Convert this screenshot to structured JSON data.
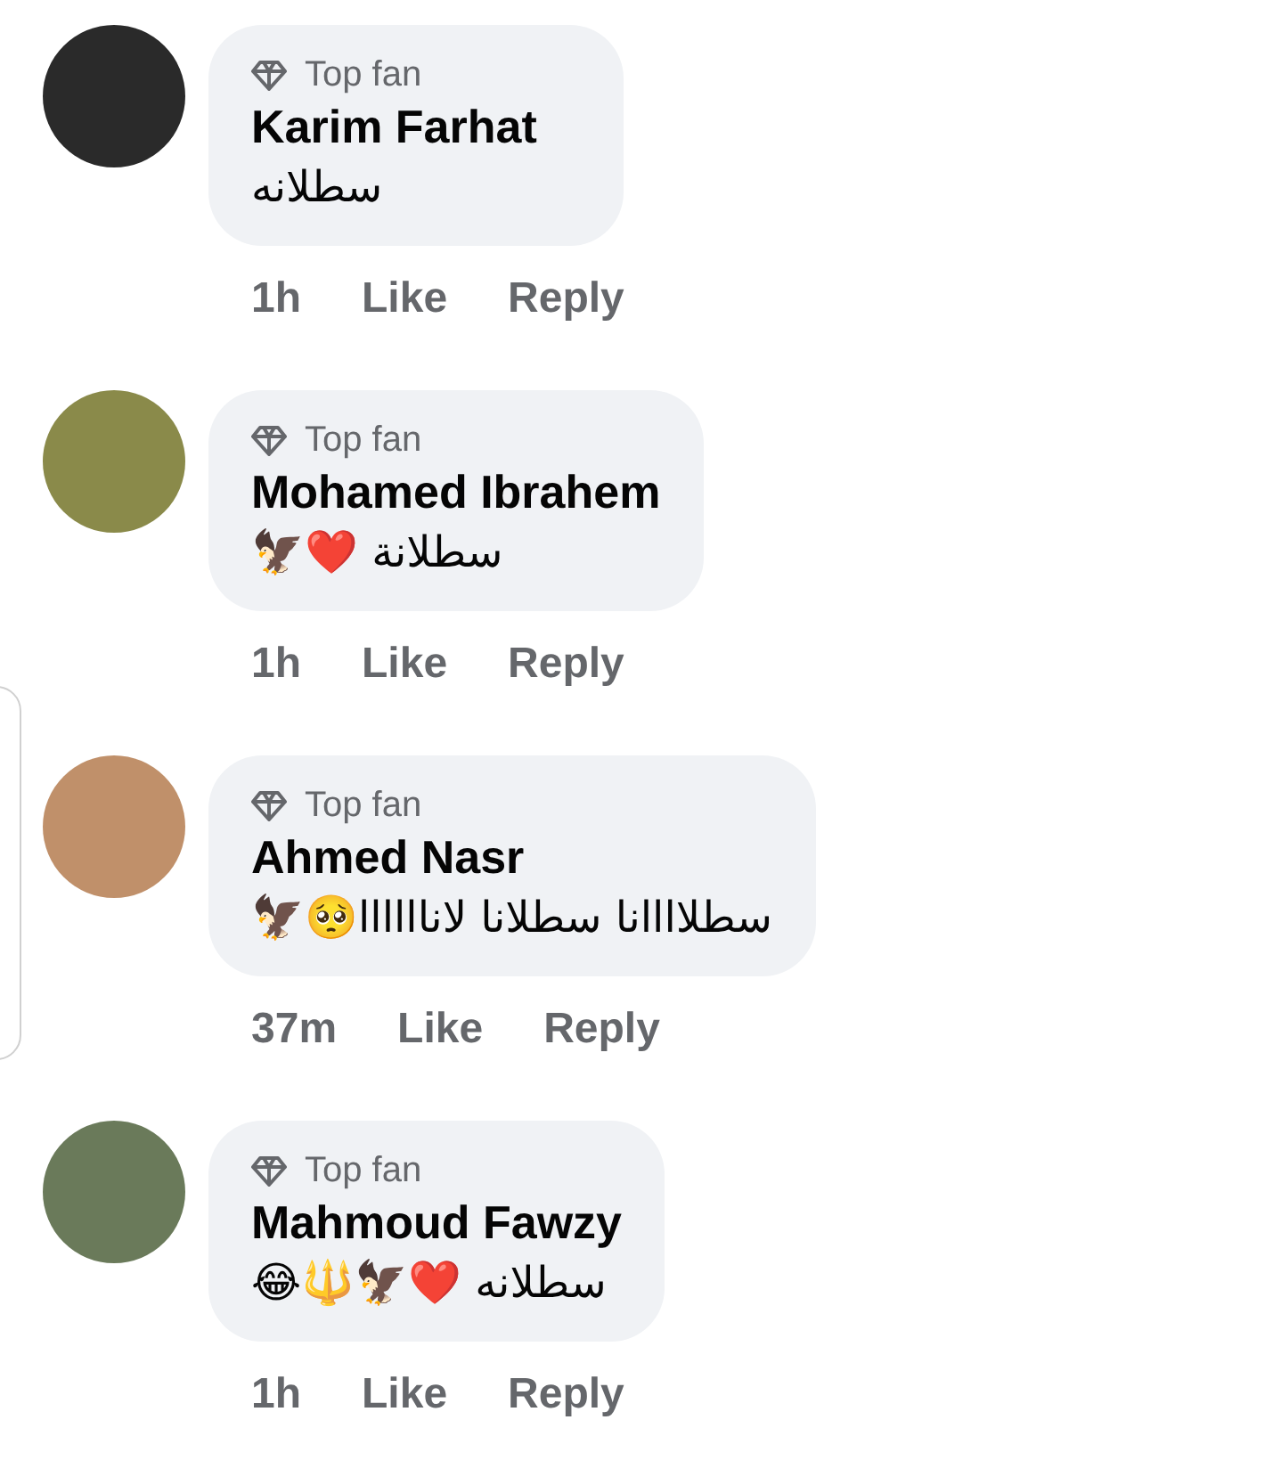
{
  "comments": [
    {
      "badge": "Top fan",
      "name": "Karim Farhat",
      "text": "سطلانه",
      "time": "1h",
      "actions": [
        "Like",
        "Reply"
      ]
    },
    {
      "badge": "Top fan",
      "name": "Mohamed Ibrahem",
      "text": "سطلانة ❤️🦅",
      "time": "1h",
      "actions": [
        "Like",
        "Reply"
      ]
    },
    {
      "badge": "Top fan",
      "name": "Ahmed Nasr",
      "text": "سطلاااانا سطلانا لاناااااا🥺🦅",
      "time": "37m",
      "actions": [
        "Like",
        "Reply"
      ]
    },
    {
      "badge": "Top fan",
      "name": "Mahmoud Fawzy",
      "text": "سطلانه ❤️🦅🔱😂",
      "time": "1h",
      "actions": [
        "Like",
        "Reply"
      ]
    }
  ]
}
